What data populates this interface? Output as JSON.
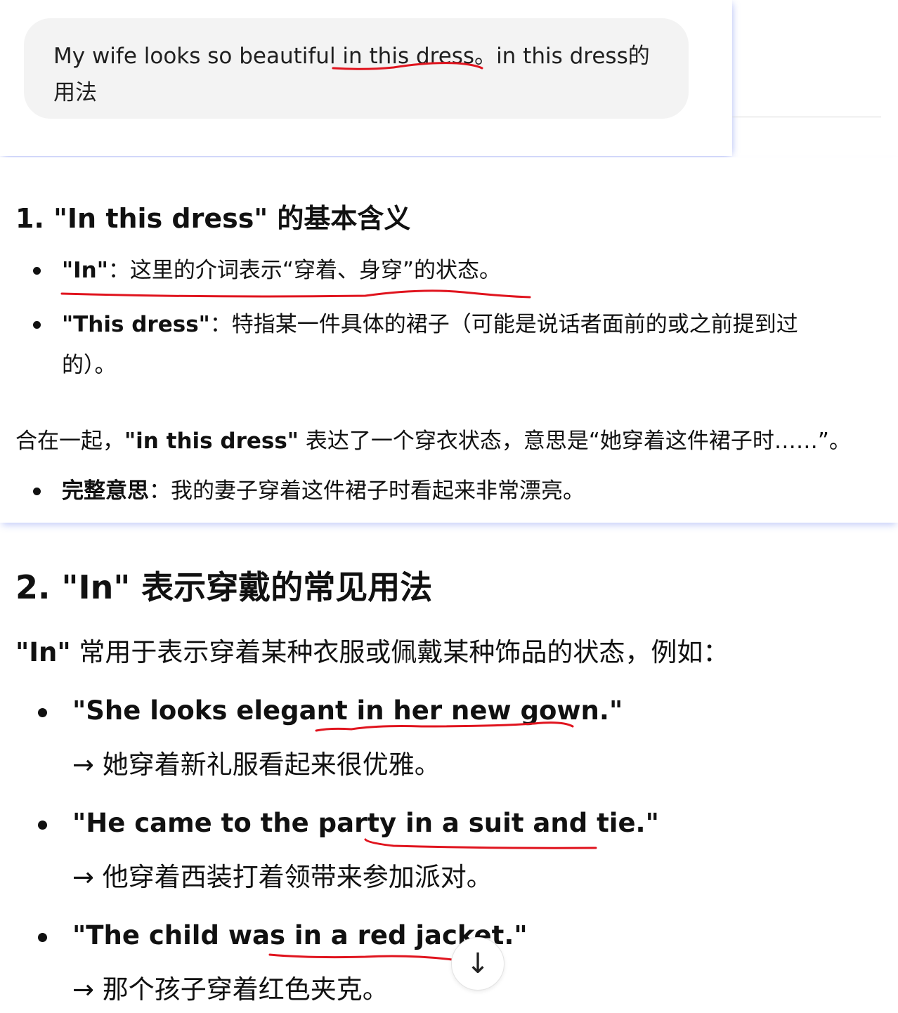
{
  "user_message": {
    "text": "My wife looks so beautiful in this dress。in this dress的",
    "text_line2": "用法"
  },
  "section1": {
    "heading": "1. \"In this dress\" 的基本含义",
    "bullets": [
      {
        "term": "\"In\"",
        "sep": "：",
        "desc": "这里的介词表示“穿着、身穿”的状态。"
      },
      {
        "term": "\"This dress\"",
        "sep": "：",
        "desc": "特指某一件具体的裙子（可能是说话者面前的或之前提到过",
        "desc_line2": "的）。"
      }
    ],
    "summary_pre": "合在一起，",
    "summary_term": "\"in this dress\"",
    "summary_post": " 表达了一个穿衣状态，意思是“她穿着这件裙子时……”。",
    "full_meaning": {
      "term": "完整意思",
      "sep": "：",
      "desc": "我的妻子穿着这件裙子时看起来非常漂亮。"
    }
  },
  "section2": {
    "heading": "2. \"In\" 表示穿戴的常见用法",
    "intro_term": "\"In\"",
    "intro_rest": " 常用于表示穿着某种衣服或佩戴某种饰品的状态，例如：",
    "examples": [
      {
        "sentence": "\"She looks elegant in her new gown.\"",
        "translation": "→ 她穿着新礼服看起来很优雅。"
      },
      {
        "sentence": "\"He came to the party in a suit and tie.\"",
        "translation": "→ 他穿着西装打着领带来参加派对。"
      },
      {
        "sentence": "\"The child was in a red jacket.\"",
        "translation": "→ 那个孩子穿着红色夹克。"
      }
    ]
  },
  "scroll_button": {
    "icon": "arrow-down-icon",
    "glyph": "↓"
  },
  "colors": {
    "annotation_red": "#e0141e",
    "bubble_bg": "#f3f3f3",
    "card_shadow": "#788cf0"
  }
}
